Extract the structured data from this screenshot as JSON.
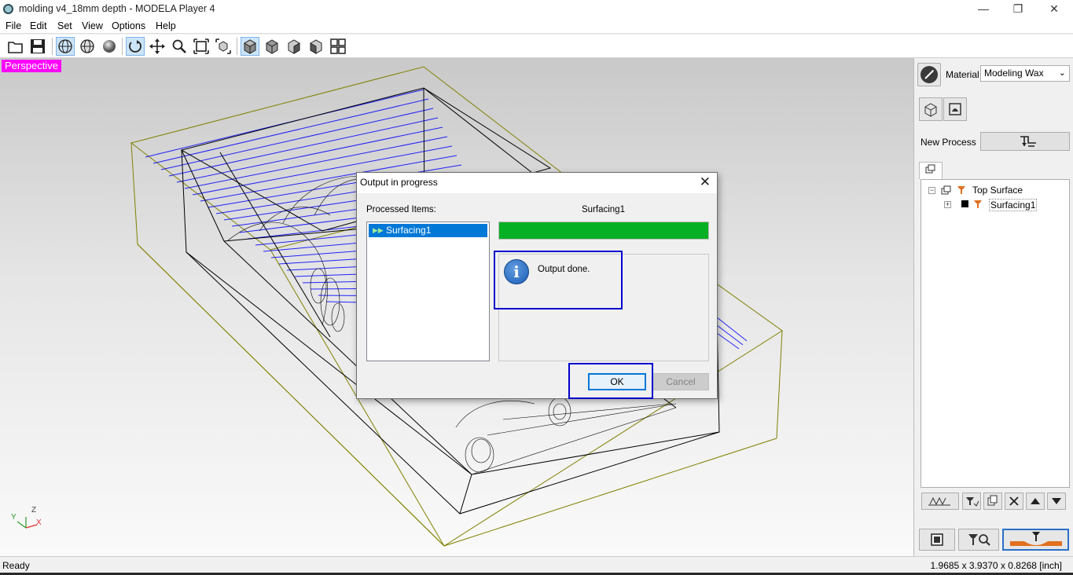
{
  "window": {
    "title": "molding v4_18mm depth  - MODELA Player 4",
    "minimize": "—",
    "restore": "❐",
    "close": "✕"
  },
  "menu": [
    "File",
    "Edit",
    "Set",
    "View",
    "Options",
    "Help"
  ],
  "toolbar": {
    "icons": [
      "open-icon",
      "save-icon",
      "wireframe-globe-icon",
      "shaded-globe-icon",
      "sphere-icon",
      "rotate-icon",
      "pan-icon",
      "zoom-icon",
      "fit-view-icon",
      "zoom-box-icon",
      "view-iso-icon",
      "view-front-icon",
      "view-side-icon",
      "view-back-icon",
      "view-quad-icon"
    ],
    "active": [
      "wireframe-globe-icon",
      "rotate-icon",
      "view-iso-icon"
    ]
  },
  "viewport": {
    "projection_label": "Perspective",
    "axis_x": "X",
    "axis_y": "Y",
    "axis_z": "Z"
  },
  "right_panel": {
    "material_label": "Material",
    "material_value": "Modeling Wax",
    "new_process_label": "New Process",
    "tree": {
      "root": "Top Surface",
      "child": "Surfacing1"
    }
  },
  "dialog": {
    "title": "Output in progress",
    "close": "✕",
    "processed_label": "Processed Items:",
    "processed_items": [
      "Surfacing1"
    ],
    "current_task": "Surfacing1",
    "progress": 1.0,
    "message": "Output done.",
    "ok_label": "OK",
    "cancel_label": "Cancel"
  },
  "status": {
    "left": "Ready",
    "right": "1.9685 x 3.9370 x 0.8268 [inch]"
  },
  "colors": {
    "perspective_bg": "#ff00ff",
    "progress_fill": "#06b025",
    "selection": "#0078d7",
    "highlight": "#0000cc",
    "toolpath": "#0000ff",
    "stock_box": "#808000"
  }
}
